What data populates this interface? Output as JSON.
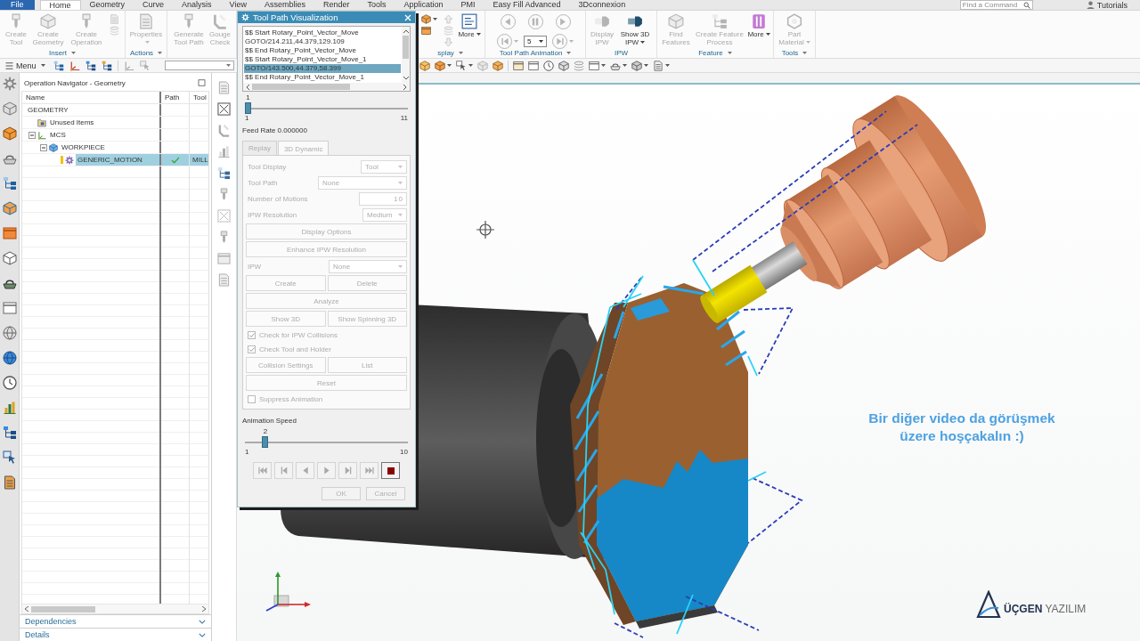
{
  "menu_tabs": [
    {
      "label": "File",
      "kind": "file",
      "selected": false
    },
    {
      "label": "Home",
      "kind": "tab",
      "selected": true
    },
    {
      "label": "Geometry",
      "kind": "tab",
      "selected": false
    },
    {
      "label": "Curve",
      "kind": "tab",
      "selected": false
    },
    {
      "label": "Analysis",
      "kind": "tab",
      "selected": false
    },
    {
      "label": "View",
      "kind": "tab",
      "selected": false
    },
    {
      "label": "Assemblies",
      "kind": "tab",
      "selected": false
    },
    {
      "label": "Render",
      "kind": "tab",
      "selected": false
    },
    {
      "label": "Tools",
      "kind": "tab",
      "selected": false
    },
    {
      "label": "Application",
      "kind": "tab",
      "selected": false
    },
    {
      "label": "PMI",
      "kind": "tab",
      "selected": false
    },
    {
      "label": "Easy Fill Advanced",
      "kind": "tab",
      "selected": false
    },
    {
      "label": "3Dconnexion",
      "kind": "tab",
      "selected": false
    }
  ],
  "command_search": {
    "placeholder": "Find a Command"
  },
  "user": {
    "name": "Tutorials"
  },
  "ribbon": {
    "groups": [
      {
        "label": "Insert",
        "dropdown": true,
        "items": [
          {
            "kind": "large",
            "label": "Create Tool",
            "disabled": true
          },
          {
            "kind": "large",
            "label": "Create Geometry",
            "disabled": true
          },
          {
            "kind": "large",
            "label": "Create Operation",
            "disabled": true
          },
          {
            "kind": "stack",
            "items": [
              {
                "disabled": true
              },
              {
                "disabled": true
              }
            ]
          }
        ]
      },
      {
        "label": "Actions",
        "dropdown": true,
        "items": [
          {
            "kind": "large",
            "label": "Properties",
            "disabled": true,
            "dropdown": true
          }
        ]
      },
      {
        "items": [
          {
            "kind": "large",
            "label": "Generate Tool Path",
            "disabled": true
          },
          {
            "kind": "large",
            "label": "Gouge Check",
            "disabled": true
          }
        ]
      },
      {
        "label": "splay",
        "dropdown": true,
        "items": [
          {
            "kind": "stack",
            "items": [
              {
                "disabled": false,
                "dropdown": true
              },
              {
                "disabled": false
              }
            ]
          },
          {
            "kind": "stack",
            "items": [
              {
                "disabled": true
              },
              {
                "disabled": true
              },
              {
                "disabled": true
              }
            ]
          },
          {
            "kind": "large",
            "label": "More",
            "disabled": false,
            "dropdown": true
          }
        ]
      },
      {
        "label": "Tool Path Animation",
        "dropdown": true,
        "items": [
          {
            "kind": "round",
            "disabled": true
          },
          {
            "kind": "round",
            "disabled": true
          },
          {
            "kind": "round",
            "disabled": true
          },
          {
            "kind": "round",
            "disabled": true,
            "dropdown": true
          },
          {
            "kind": "spinner",
            "value": "5"
          },
          {
            "kind": "round",
            "disabled": true,
            "dropdown": true
          }
        ]
      },
      {
        "label": "IPW",
        "items": [
          {
            "kind": "large",
            "label": "Display IPW",
            "disabled": true
          },
          {
            "kind": "large",
            "label": "Show 3D IPW",
            "disabled": false,
            "dropdown": true
          }
        ]
      },
      {
        "label": "Feature",
        "dropdown": true,
        "items": [
          {
            "kind": "large",
            "label": "Find Features",
            "disabled": true
          },
          {
            "kind": "large",
            "label": "Create Feature Process",
            "disabled": true
          },
          {
            "kind": "large",
            "label": "More",
            "disabled": false,
            "dropdown": true
          }
        ]
      },
      {
        "label": "Tools",
        "dropdown": true,
        "items": [
          {
            "kind": "large",
            "label": "Part Material",
            "disabled": true,
            "dropdown": true
          }
        ]
      }
    ]
  },
  "toolbar": {
    "menu_label": "Menu"
  },
  "navigator": {
    "title": "Operation Navigator - Geometry",
    "columns": [
      "Name",
      "Path",
      "Tool"
    ],
    "rows": [
      {
        "name": "GEOMETRY",
        "selected": false,
        "children": [
          {
            "name": "Unused Items",
            "kind": "folder",
            "selected": false
          },
          {
            "name": "MCS",
            "kind": "mcs",
            "expanded": true,
            "selected": false,
            "children": [
              {
                "name": "WORKPIECE",
                "kind": "workpiece",
                "expanded": true,
                "selected": false,
                "children": [
                  {
                    "name": "GENERIC_MOTION",
                    "kind": "operation",
                    "warning": true,
                    "path_generated": true,
                    "tool": "MILL",
                    "selected": true
                  }
                ]
              }
            ]
          }
        ]
      }
    ],
    "panels": [
      {
        "label": "Dependencies",
        "expanded": false
      },
      {
        "label": "Details",
        "expanded": false
      }
    ]
  },
  "dialog": {
    "title": "Tool Path Visualization",
    "listing": [
      {
        "text": "$$ Start Rotary_Point_Vector_Move",
        "selected": false
      },
      {
        "text": "GOTO/214.211,44.379,129.109",
        "selected": false
      },
      {
        "text": "$$ End Rotary_Point_Vector_Move",
        "selected": false
      },
      {
        "text": "$$ Start Rotary_Point_Vector_Move_1",
        "selected": false
      },
      {
        "text": "GOTO/143.500,44.379,58.399",
        "selected": true
      },
      {
        "text": "$$ End Rotary_Point_Vector_Move_1",
        "selected": false
      }
    ],
    "motion_slider": {
      "value": "1",
      "min": "1",
      "max": "11",
      "level": 0
    },
    "feed_rate": "Feed Rate 0.000000",
    "tabs": [
      {
        "label": "Replay",
        "selected": false,
        "disabled": true
      },
      {
        "label": "3D Dynamic",
        "selected": true,
        "disabled": true
      }
    ],
    "panel": {
      "disabled": true,
      "rows": [
        {
          "kind": "dropdown",
          "label": "Tool Display",
          "value": "Tool"
        },
        {
          "kind": "dropdown",
          "label": "Tool Path",
          "value": "None"
        },
        {
          "kind": "number",
          "label": "Number of Motions",
          "value": "10"
        },
        {
          "kind": "dropdown",
          "label": "IPW Resolution",
          "value": "Medium"
        },
        {
          "kind": "buttons",
          "buttons": [
            "Display Options"
          ]
        },
        {
          "kind": "buttons",
          "buttons": [
            "Enhance IPW Resolution"
          ]
        },
        {
          "kind": "dropdown",
          "label": "IPW",
          "value": "None"
        },
        {
          "kind": "buttons",
          "buttons": [
            "Create",
            "Delete"
          ]
        },
        {
          "kind": "buttons",
          "buttons": [
            "Analyze"
          ]
        },
        {
          "kind": "buttons",
          "buttons": [
            "Show 3D",
            "Show Spinning 3D"
          ]
        },
        {
          "kind": "checkbox",
          "label": "Check for IPW Collisions",
          "checked": true
        },
        {
          "kind": "checkbox",
          "label": "Check Tool and Holder",
          "checked": true
        },
        {
          "kind": "buttons",
          "buttons": [
            "Collision Settings",
            "List"
          ]
        },
        {
          "kind": "buttons",
          "buttons": [
            "Reset"
          ]
        },
        {
          "kind": "checkbox",
          "label": "Suppress Animation",
          "checked": false
        }
      ]
    },
    "animation_speed": {
      "label": "Animation Speed",
      "value": "2",
      "min": "1",
      "max": "10",
      "level": 0.11
    },
    "playback": [
      {
        "kind": "first",
        "disabled": true
      },
      {
        "kind": "previous",
        "disabled": true
      },
      {
        "kind": "reverse",
        "disabled": true
      },
      {
        "kind": "play",
        "disabled": true
      },
      {
        "kind": "next",
        "disabled": true
      },
      {
        "kind": "last",
        "disabled": true
      },
      {
        "kind": "stop",
        "disabled": false
      }
    ],
    "buttons": [
      {
        "label": "OK",
        "disabled": true
      },
      {
        "label": "Cancel",
        "disabled": true
      }
    ]
  },
  "viewport": {
    "message": "Bir diğer video da görüşmek üzere hoşçakalın :)",
    "logo": "**ÜÇGEN** YAZILIM"
  }
}
